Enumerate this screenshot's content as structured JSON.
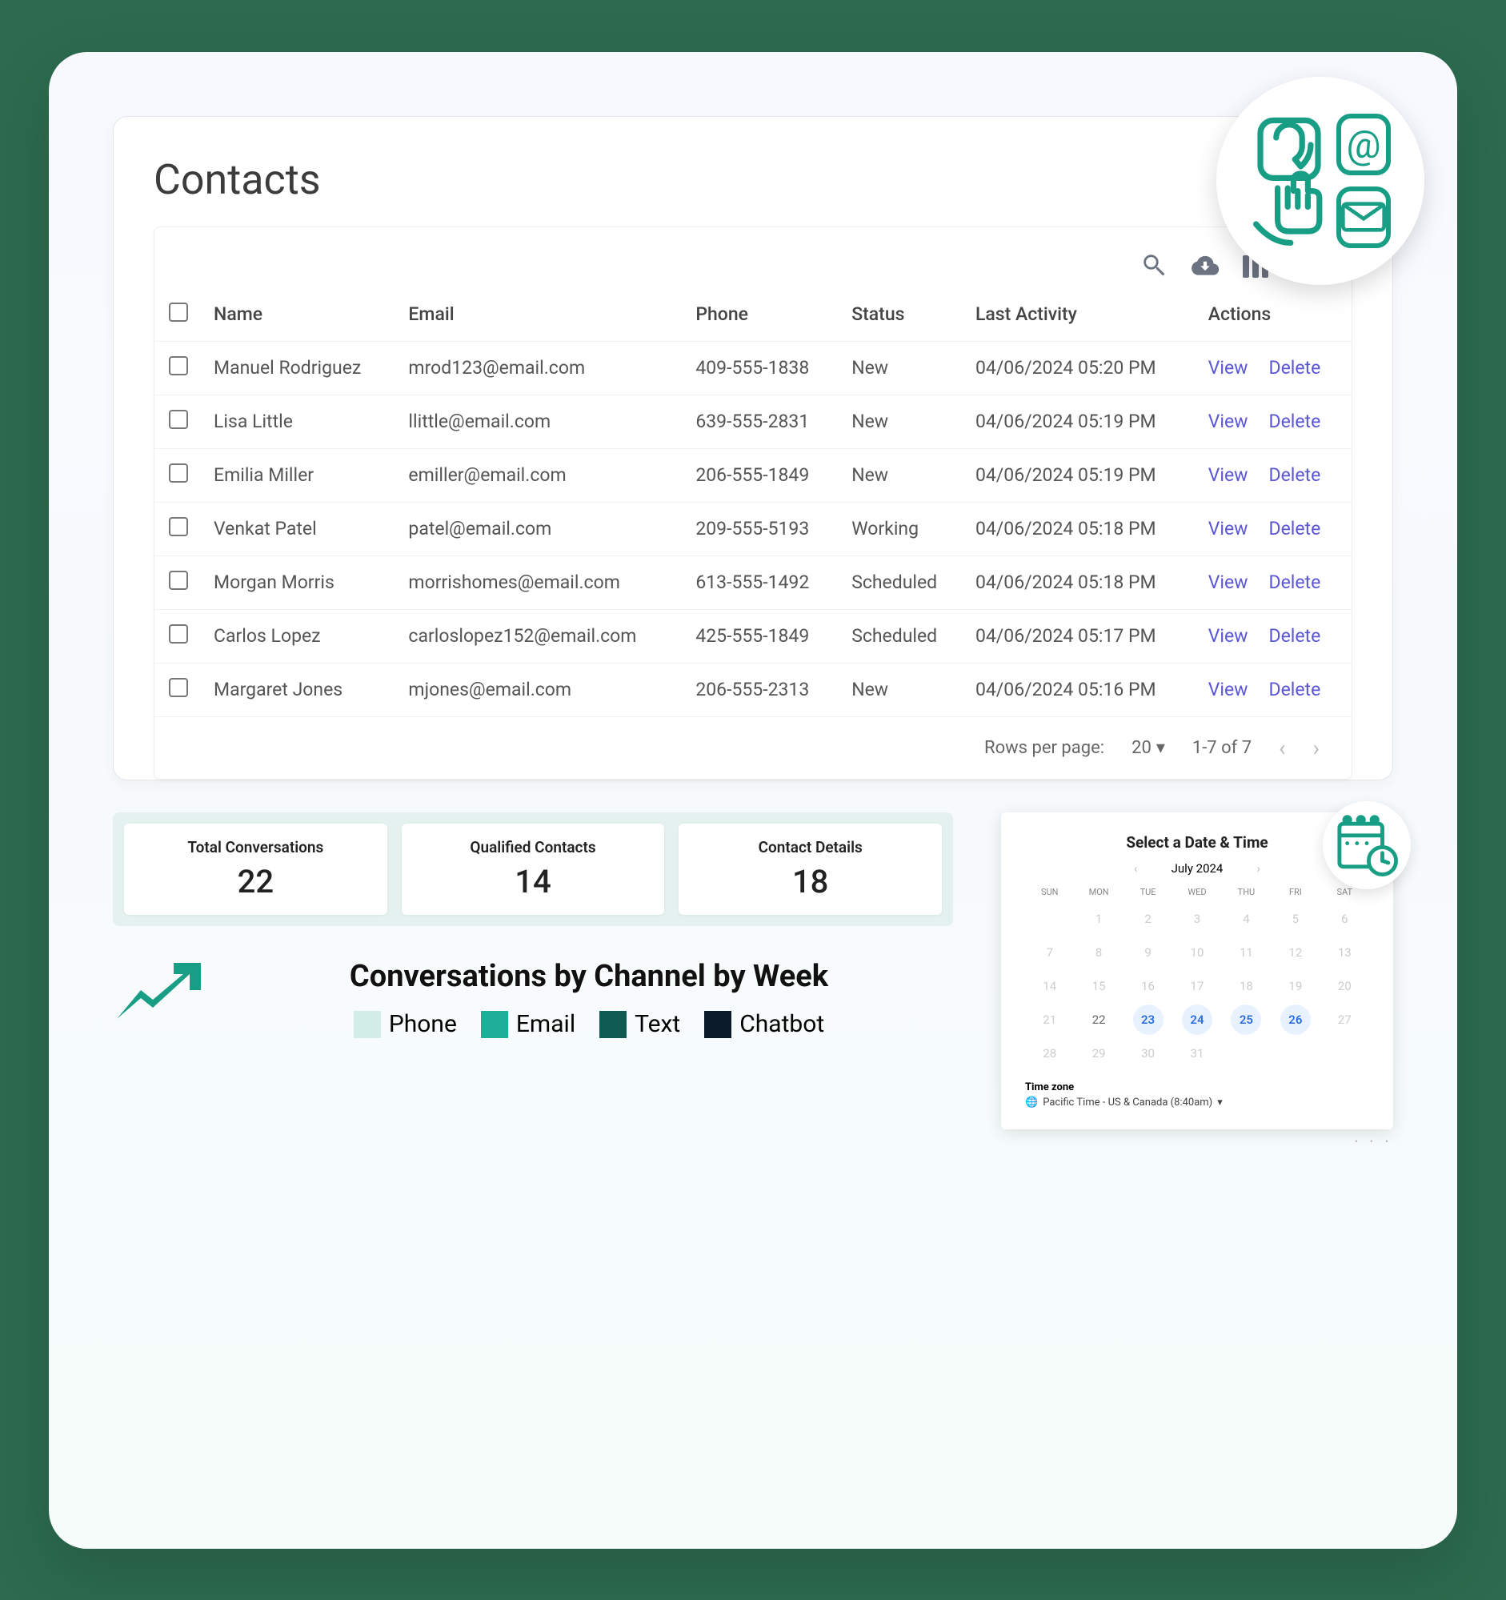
{
  "contacts": {
    "title": "Contacts",
    "columns": [
      "Name",
      "Email",
      "Phone",
      "Status",
      "Last Activity",
      "Actions"
    ],
    "rows": [
      {
        "name": "Manuel Rodriguez",
        "email": "mrod123@email.com",
        "phone": "409-555-1838",
        "status": "New",
        "last": "04/06/2024 05:20 PM",
        "view": "View",
        "del": "Delete"
      },
      {
        "name": "Lisa Little",
        "email": "llittle@email.com",
        "phone": "639-555-2831",
        "status": "New",
        "last": "04/06/2024 05:19 PM",
        "view": "View",
        "del": "Delete"
      },
      {
        "name": "Emilia Miller",
        "email": "emiller@email.com",
        "phone": "206-555-1849",
        "status": "New",
        "last": "04/06/2024 05:19 PM",
        "view": "View",
        "del": "Delete"
      },
      {
        "name": "Venkat Patel",
        "email": "patel@email.com",
        "phone": "209-555-5193",
        "status": "Working",
        "last": "04/06/2024 05:18 PM",
        "view": "View",
        "del": "Delete"
      },
      {
        "name": "Morgan Morris",
        "email": "morrishomes@email.com",
        "phone": "613-555-1492",
        "status": "Scheduled",
        "last": "04/06/2024 05:18 PM",
        "view": "View",
        "del": "Delete"
      },
      {
        "name": "Carlos Lopez",
        "email": "carloslopez152@email.com",
        "phone": "425-555-1849",
        "status": "Scheduled",
        "last": "04/06/2024 05:17 PM",
        "view": "View",
        "del": "Delete"
      },
      {
        "name": "Margaret Jones",
        "email": "mjones@email.com",
        "phone": "206-555-2313",
        "status": "New",
        "last": "04/06/2024 05:16 PM",
        "view": "View",
        "del": "Delete"
      }
    ],
    "pager": {
      "rows_label": "Rows per page:",
      "rows_value": "20",
      "range": "1-7 of 7"
    }
  },
  "stats": [
    {
      "label": "Total Conversations",
      "value": "22"
    },
    {
      "label": "Qualified Contacts",
      "value": "14"
    },
    {
      "label": "Contact Details",
      "value": "18"
    }
  ],
  "chart": {
    "title": "Conversations by Channel by Week",
    "legend": [
      {
        "label": "Phone",
        "color": "#d3eee9"
      },
      {
        "label": "Email",
        "color": "#1fae97"
      },
      {
        "label": "Text",
        "color": "#0f5b54"
      },
      {
        "label": "Chatbot",
        "color": "#0a1a2b"
      }
    ]
  },
  "calendar": {
    "title": "Select a Date & Time",
    "month": "July 2024",
    "dow": [
      "SUN",
      "MON",
      "TUE",
      "WED",
      "THU",
      "FRI",
      "SAT"
    ],
    "days": [
      {
        "n": "",
        "muted": true
      },
      {
        "n": "1",
        "muted": true
      },
      {
        "n": "2",
        "muted": true
      },
      {
        "n": "3",
        "muted": true
      },
      {
        "n": "4",
        "muted": true
      },
      {
        "n": "5",
        "muted": true
      },
      {
        "n": "6",
        "muted": true
      },
      {
        "n": "7",
        "muted": true
      },
      {
        "n": "8",
        "muted": true
      },
      {
        "n": "9",
        "muted": true
      },
      {
        "n": "10",
        "muted": true
      },
      {
        "n": "11",
        "muted": true
      },
      {
        "n": "12",
        "muted": true
      },
      {
        "n": "13",
        "muted": true
      },
      {
        "n": "14",
        "muted": true
      },
      {
        "n": "15",
        "muted": true
      },
      {
        "n": "16",
        "muted": true
      },
      {
        "n": "17",
        "muted": true
      },
      {
        "n": "18",
        "muted": true
      },
      {
        "n": "19",
        "muted": true
      },
      {
        "n": "20",
        "muted": true
      },
      {
        "n": "21",
        "muted": true
      },
      {
        "n": "22",
        "muted": false
      },
      {
        "n": "23",
        "avail": true
      },
      {
        "n": "24",
        "avail": true
      },
      {
        "n": "25",
        "avail": true
      },
      {
        "n": "26",
        "avail": true
      },
      {
        "n": "27",
        "muted": true
      },
      {
        "n": "28",
        "muted": true
      },
      {
        "n": "29",
        "muted": true
      },
      {
        "n": "30",
        "muted": true
      },
      {
        "n": "31",
        "muted": true
      },
      {
        "n": "",
        "muted": true
      },
      {
        "n": "",
        "muted": true
      },
      {
        "n": "",
        "muted": true
      }
    ],
    "tz_label": "Time zone",
    "tz_value": "Pacific Time - US & Canada (8:40am)"
  }
}
